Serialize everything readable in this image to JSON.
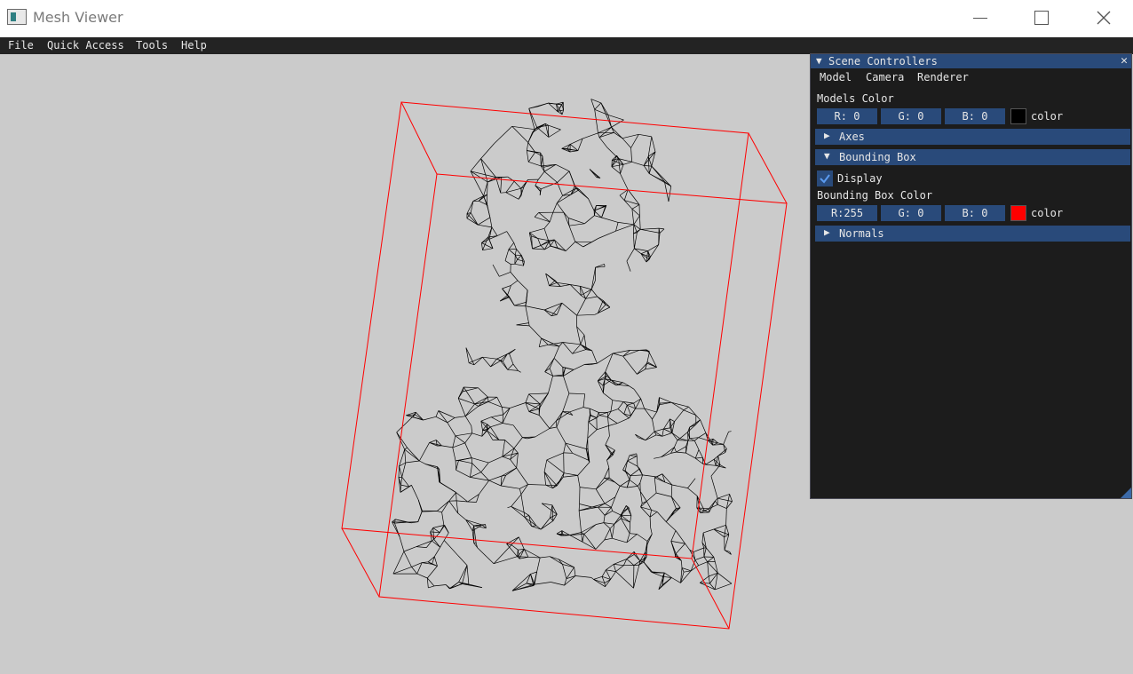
{
  "window": {
    "title": "Mesh Viewer",
    "controls": [
      "minimize-icon",
      "maximize-icon",
      "close-icon"
    ]
  },
  "menubar": {
    "items": [
      "File",
      "Quick Access",
      "Tools",
      "Help"
    ]
  },
  "panel": {
    "title": "Scene Controllers",
    "tabs": [
      "Model",
      "Camera",
      "Renderer"
    ],
    "models_color": {
      "label": "Models Color",
      "r": "R:  0",
      "g": "G:  0",
      "b": "B:  0",
      "swatch": "#000000",
      "swatch_label": "color"
    },
    "sections": {
      "axes": "Axes",
      "bounding_box": "Bounding Box",
      "normals": "Normals"
    },
    "bounding_box": {
      "display_label": "Display",
      "display_checked": true,
      "color_label": "Bounding Box Color",
      "r": "R:255",
      "g": "G:  0",
      "b": "B:  0",
      "swatch": "#ff0000",
      "swatch_label": "color"
    }
  },
  "colors": {
    "viewport_bg": "#cbcbcb",
    "bbox_line": "#ff0000",
    "mesh_line": "#000000",
    "accent": "#294a7a"
  }
}
